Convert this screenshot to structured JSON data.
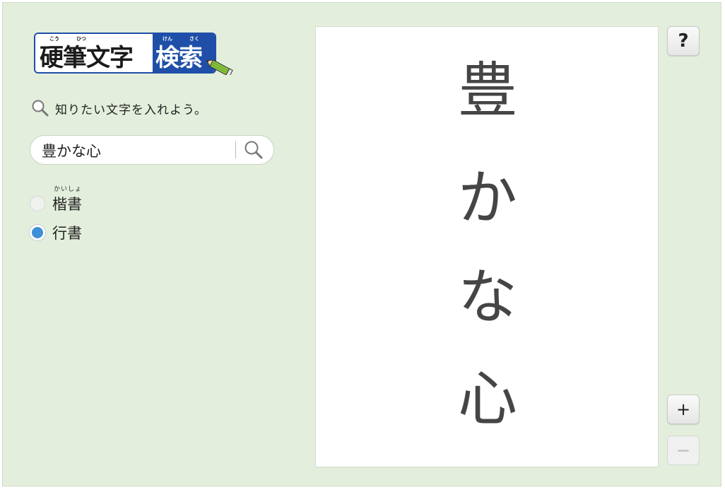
{
  "logo": {
    "main_left": "硬筆文字",
    "main_right": "検索",
    "ruby_kou": "こう",
    "ruby_hitsu": "ひつ",
    "ruby_ken": "けん",
    "ruby_saku": "さく"
  },
  "instruction": {
    "text": "知りたい文字を入れよう。",
    "icon": "search-icon"
  },
  "search": {
    "value": "豊かな心",
    "placeholder": "",
    "button_icon": "search-icon"
  },
  "styles": {
    "options": [
      {
        "label": "楷書",
        "ruby": "かいしょ",
        "selected": false
      },
      {
        "label": "行書",
        "ruby": "",
        "selected": true
      }
    ]
  },
  "result": {
    "characters": [
      "豊",
      "か",
      "な",
      "心"
    ]
  },
  "buttons": {
    "help": "?",
    "zoom_in": "+",
    "zoom_out": "−"
  },
  "colors": {
    "background": "#e3efdc",
    "logo_blue": "#1f4fa8",
    "radio_selected": "#3e8fd6"
  }
}
